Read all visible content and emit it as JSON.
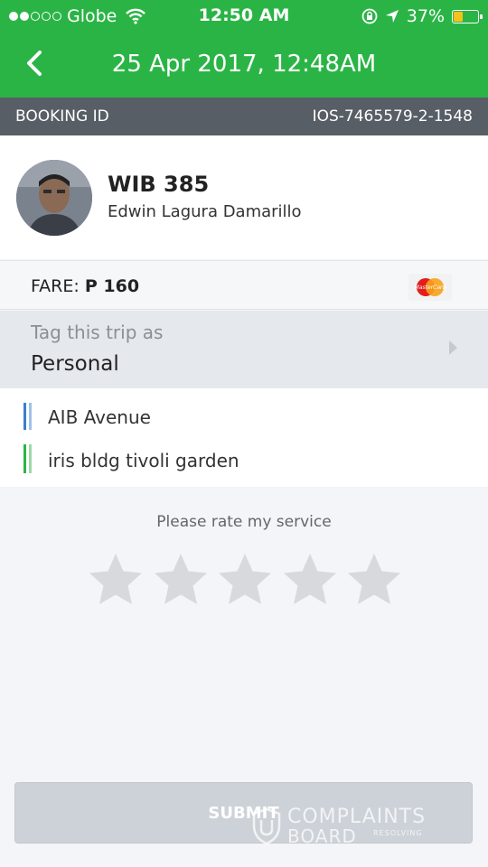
{
  "status_bar": {
    "carrier": "Globe",
    "time": "12:50 AM",
    "battery": "37%",
    "battery_level": 0.37
  },
  "nav": {
    "title": "25 Apr 2017, 12:48AM",
    "back_icon": "chevron-left-icon"
  },
  "booking": {
    "label": "BOOKING ID",
    "id": "IOS-7465579-2-1548"
  },
  "driver": {
    "plate": "WIB 385",
    "name": "Edwin Lagura Damarillo"
  },
  "fare": {
    "label": "FARE:",
    "amount": "P 160",
    "payment_icon": "mastercard-icon",
    "card_text": "MasterCard"
  },
  "tag": {
    "label": "Tag this trip as",
    "value": "Personal"
  },
  "route": {
    "pickup": "AIB Avenue",
    "dropoff": "iris bldg tivoli garden"
  },
  "rating": {
    "prompt": "Please rate my service",
    "stars_total": 5,
    "stars_selected": 0
  },
  "submit": {
    "label": "SUBMIT"
  },
  "watermark": {
    "line1": "COMPLAINTS",
    "line2": "BOARD",
    "line3": "RESOLVING"
  },
  "colors": {
    "brand_green": "#2bb446",
    "booking_bar": "#585e66",
    "star_inactive": "#d7d9dc",
    "pickup_line": "#3a7fcf",
    "dropoff_line": "#2bb446"
  }
}
